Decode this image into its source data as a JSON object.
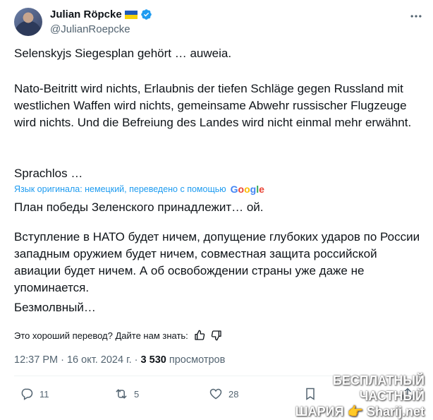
{
  "author": {
    "name": "Julian Röpcke",
    "handle": "@JulianRoepcke",
    "flag": "ukraine-flag",
    "badge": "verified-badge-icon"
  },
  "original_text": {
    "p1": "Selenskyjs Siegesplan gehört … auweia.",
    "p2": "Nato-Beitritt wird nichts, Erlaubnis der tiefen Schläge gegen Russland mit westlichen Waffen wird nichts, gemeinsame Abwehr russischer Flugzeuge wird nichts. Und die Befreiung des Landes wird nicht einmal mehr erwähnt.",
    "p3": "Sprachlos …"
  },
  "translation": {
    "notice": "Язык оригинала: немецкий, переведено с помощью",
    "provider": "Google",
    "p1": "План победы Зеленского принадлежит… ой.",
    "p2": "Вступление в НАТО будет ничем, допущение глубоких ударов по России западным оружием будет ничем, совместная защита российской авиации будет ничем. А об освобождении страны уже даже не упоминается.",
    "p3": "Безмолвный…",
    "feedback": "Это хороший перевод? Дайте нам знать:"
  },
  "meta": {
    "time": "12:37 PM",
    "sep1": "·",
    "date": "16 окт. 2024 г.",
    "sep2": "·",
    "views": "3 530",
    "views_label": "просмотров"
  },
  "actions": {
    "replies": "11",
    "reposts": "5",
    "likes": "28"
  },
  "watermark": {
    "line1": "БЕСПЛАТНЫЙ ЧАСТНЫЙ",
    "line2": "ШАРИЯ 👉 Sharij.net"
  },
  "colors": {
    "text": "#0f1419",
    "secondary": "#536471",
    "link": "#1d9bf0",
    "verified": "#1d9bf0"
  }
}
